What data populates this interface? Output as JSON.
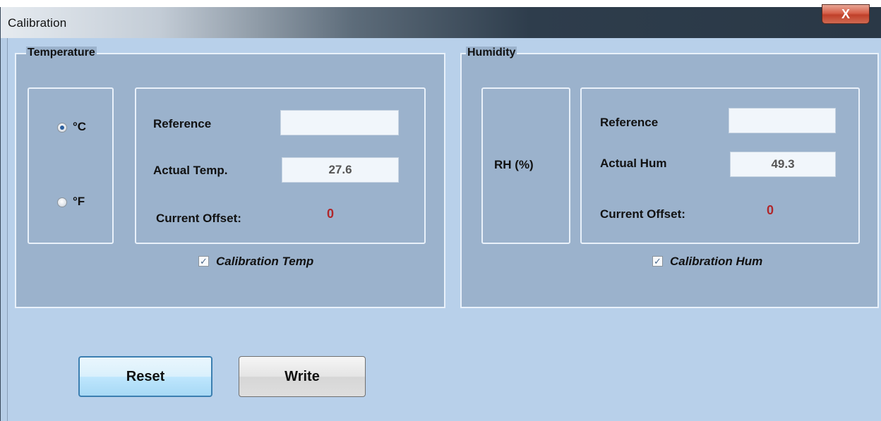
{
  "window": {
    "title": "Calibration",
    "close_label": "X"
  },
  "temperature": {
    "group_title": "Temperature",
    "units": [
      {
        "label": "°C",
        "selected": true
      },
      {
        "label": "°F",
        "selected": false
      }
    ],
    "reference_label": "Reference",
    "reference_value": "",
    "actual_label": "Actual Temp.",
    "actual_value": "27.6",
    "offset_label": "Current Offset:",
    "offset_value": "0",
    "calibration_label": "Calibration Temp",
    "calibration_checked": true
  },
  "humidity": {
    "group_title": "Humidity",
    "unit_label": "RH (%)",
    "reference_label": "Reference",
    "reference_value": "",
    "actual_label": "Actual Hum",
    "actual_value": "49.3",
    "offset_label": "Current Offset:",
    "offset_value": "0",
    "calibration_label": "Calibration Hum",
    "calibration_checked": true
  },
  "buttons": {
    "reset": "Reset",
    "write": "Write"
  },
  "colors": {
    "offset_value": "#b0262a",
    "group_bg": "#9bb2cc",
    "client_bg": "#b8d0ea"
  }
}
